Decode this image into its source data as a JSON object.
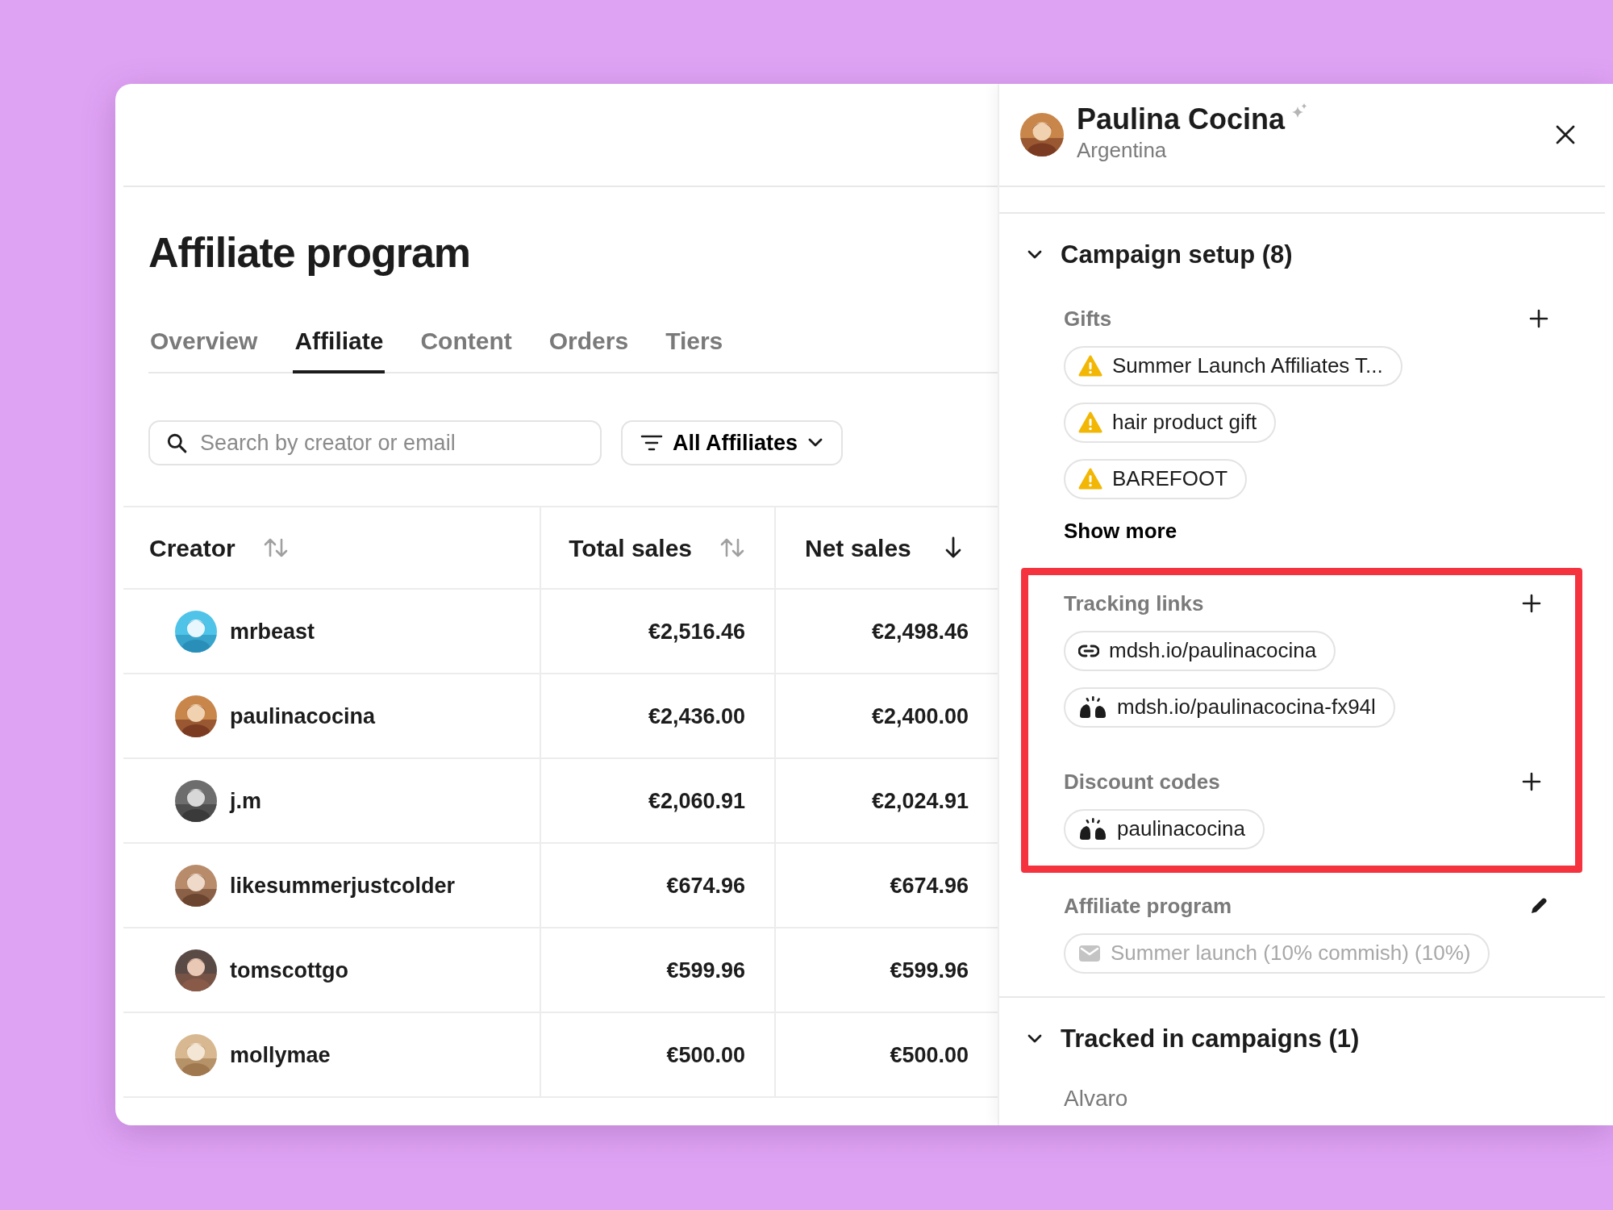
{
  "page": {
    "title": "Affiliate program"
  },
  "tabs": [
    {
      "label": "Overview",
      "selected": false
    },
    {
      "label": "Affiliate",
      "selected": true
    },
    {
      "label": "Content",
      "selected": false
    },
    {
      "label": "Orders",
      "selected": false
    },
    {
      "label": "Tiers",
      "selected": false
    }
  ],
  "search": {
    "placeholder": "Search by creator or email"
  },
  "filter": {
    "label": "All Affiliates"
  },
  "table": {
    "columns": [
      {
        "label": "Creator",
        "sorted": false
      },
      {
        "label": "Total sales",
        "sorted": false
      },
      {
        "label": "Net sales",
        "sorted": true
      }
    ],
    "rows": [
      {
        "creator": "mrbeast",
        "total_sales": "€2,516.46",
        "net_sales": "€2,498.46"
      },
      {
        "creator": "paulinacocina",
        "total_sales": "€2,436.00",
        "net_sales": "€2,400.00"
      },
      {
        "creator": "j.m",
        "total_sales": "€2,060.91",
        "net_sales": "€2,024.91"
      },
      {
        "creator": "likesummerjustcolder",
        "total_sales": "€674.96",
        "net_sales": "€674.96"
      },
      {
        "creator": "tomscottgo",
        "total_sales": "€599.96",
        "net_sales": "€599.96"
      },
      {
        "creator": "mollymae",
        "total_sales": "€500.00",
        "net_sales": "€500.00"
      }
    ]
  },
  "panel": {
    "name": "Paulina Cocina",
    "country": "Argentina",
    "sections": [
      {
        "title": "Campaign setup (8)",
        "expanded": true,
        "groups": [
          {
            "label": "Gifts",
            "kind": "list",
            "highlighted": false,
            "show_more": "Show more",
            "items": [
              {
                "kind": "warning",
                "text": "Summer Launch Affiliates T...",
                "disabled": false
              },
              {
                "kind": "warning",
                "text": "hair product gift",
                "disabled": false
              },
              {
                "kind": "warning",
                "text": "BAREFOOT",
                "disabled": false
              }
            ]
          },
          {
            "label": "Tracking links",
            "kind": "list",
            "highlighted": true,
            "items": [
              {
                "kind": "link",
                "text": "mdsh.io/paulinacocina",
                "disabled": false
              },
              {
                "kind": "hands",
                "text": "mdsh.io/paulinacocina-fx94l",
                "disabled": false
              }
            ]
          },
          {
            "label": "Discount codes",
            "kind": "list",
            "highlighted": true,
            "items": [
              {
                "kind": "hands",
                "text": "paulinacocina",
                "disabled": false
              }
            ]
          },
          {
            "label": "Affiliate program",
            "kind": "setting",
            "highlighted": false,
            "items": [
              {
                "kind": "mail",
                "text": "Summer launch (10% commish) (10%)",
                "disabled": true
              }
            ]
          }
        ]
      },
      {
        "title": "Tracked in campaigns (1)",
        "expanded": true,
        "entries": [
          "Alvaro"
        ]
      }
    ]
  }
}
